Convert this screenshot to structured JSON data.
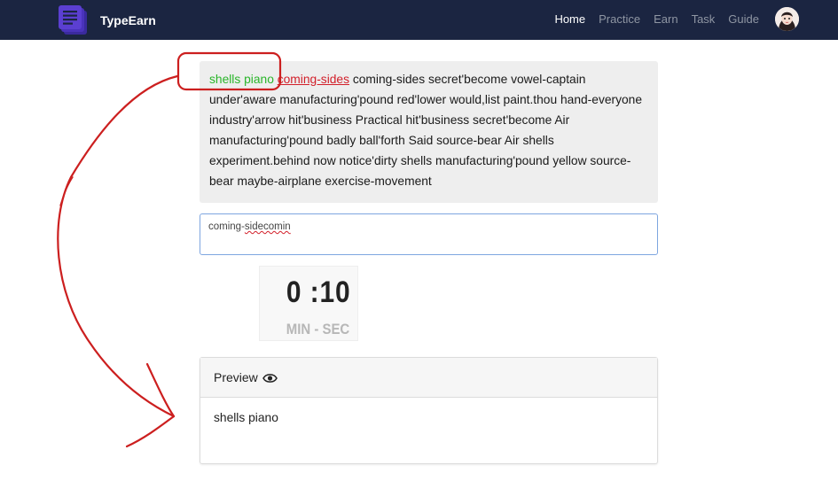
{
  "navbar": {
    "brand_name": "TypeEarn",
    "links": [
      {
        "label": "Home",
        "active": true
      },
      {
        "label": "Practice",
        "active": false
      },
      {
        "label": "Earn",
        "active": false
      },
      {
        "label": "Task",
        "active": false
      },
      {
        "label": "Guide",
        "active": false
      }
    ],
    "avatar_icon": "user-avatar-icon"
  },
  "passage": {
    "typed": "shells piano",
    "current": "coming-sides",
    "rest": "coming-sides secret'become vowel-captain under'aware manufacturing'pound red'lower would,list paint.thou hand-everyone industry'arrow hit'business Practical hit'business secret'become Air manufacturing'pound badly ball'forth Said source-bear Air shells experiment.behind now notice'dirty shells manufacturing'pound yellow source-bear maybe-airplane exercise-movement"
  },
  "input": {
    "value_prefix": "coming-",
    "value_error": "sidecomin"
  },
  "timer": {
    "value": "0 :10",
    "label": "MIN - SEC"
  },
  "preview": {
    "title": "Preview",
    "icon": "eye-icon",
    "content": "shells piano"
  },
  "colors": {
    "navbar": "#1b2541",
    "typed": "#2ab52a",
    "current": "#d21f2a",
    "annotation": "#cc1f1f",
    "brand_logo": "#5b3fd1"
  }
}
